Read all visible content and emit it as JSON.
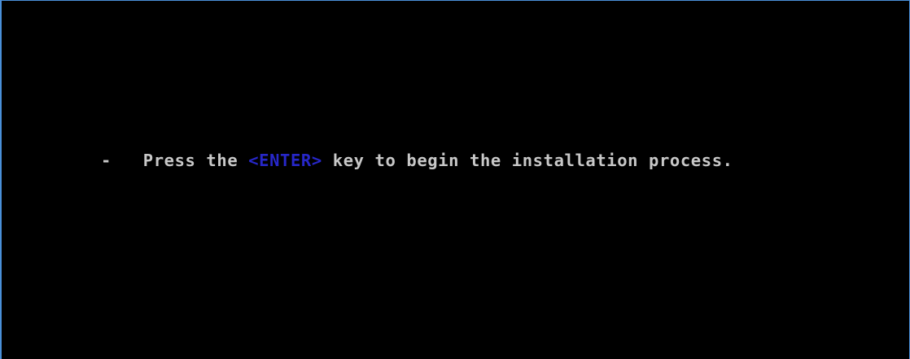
{
  "console": {
    "bullet": "-",
    "text_before": "Press the",
    "key": "<ENTER>",
    "text_after": "key to begin the installation process.",
    "colors": {
      "background": "#000000",
      "text": "#c8c8c8",
      "key": "#2727c9",
      "frame_border": "#4a90d9"
    }
  }
}
